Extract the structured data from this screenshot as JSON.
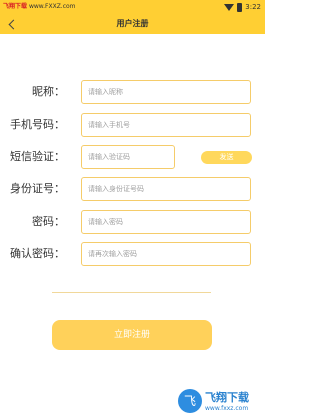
{
  "status_bar": {
    "brand": "飞翔下载",
    "url": "www.FXXZ.com",
    "time": "3:22"
  },
  "nav": {
    "title": "用户注册"
  },
  "form": {
    "nickname": {
      "label": "昵称：",
      "placeholder": "请输入昵称"
    },
    "phone": {
      "label": "手机号码：",
      "placeholder": "请输入手机号"
    },
    "sms_code": {
      "label": "短信验证：",
      "placeholder": "请输入验证码",
      "send_label": "发送"
    },
    "id_number": {
      "label": "身份证号：",
      "placeholder": "请输入身份证号码"
    },
    "password": {
      "label": "密码：",
      "placeholder": "请输入密码"
    },
    "confirm_password": {
      "label": "确认密码：",
      "placeholder": "请再次输入密码"
    }
  },
  "submit": {
    "label": "立即注册"
  },
  "watermark": {
    "logo_char": "飞",
    "text": "飞翔下载",
    "url": "www.fxxz.com"
  },
  "colors": {
    "accent": "#ffcf33",
    "button": "#ffd15a",
    "field_border": "#f5cc6a"
  }
}
